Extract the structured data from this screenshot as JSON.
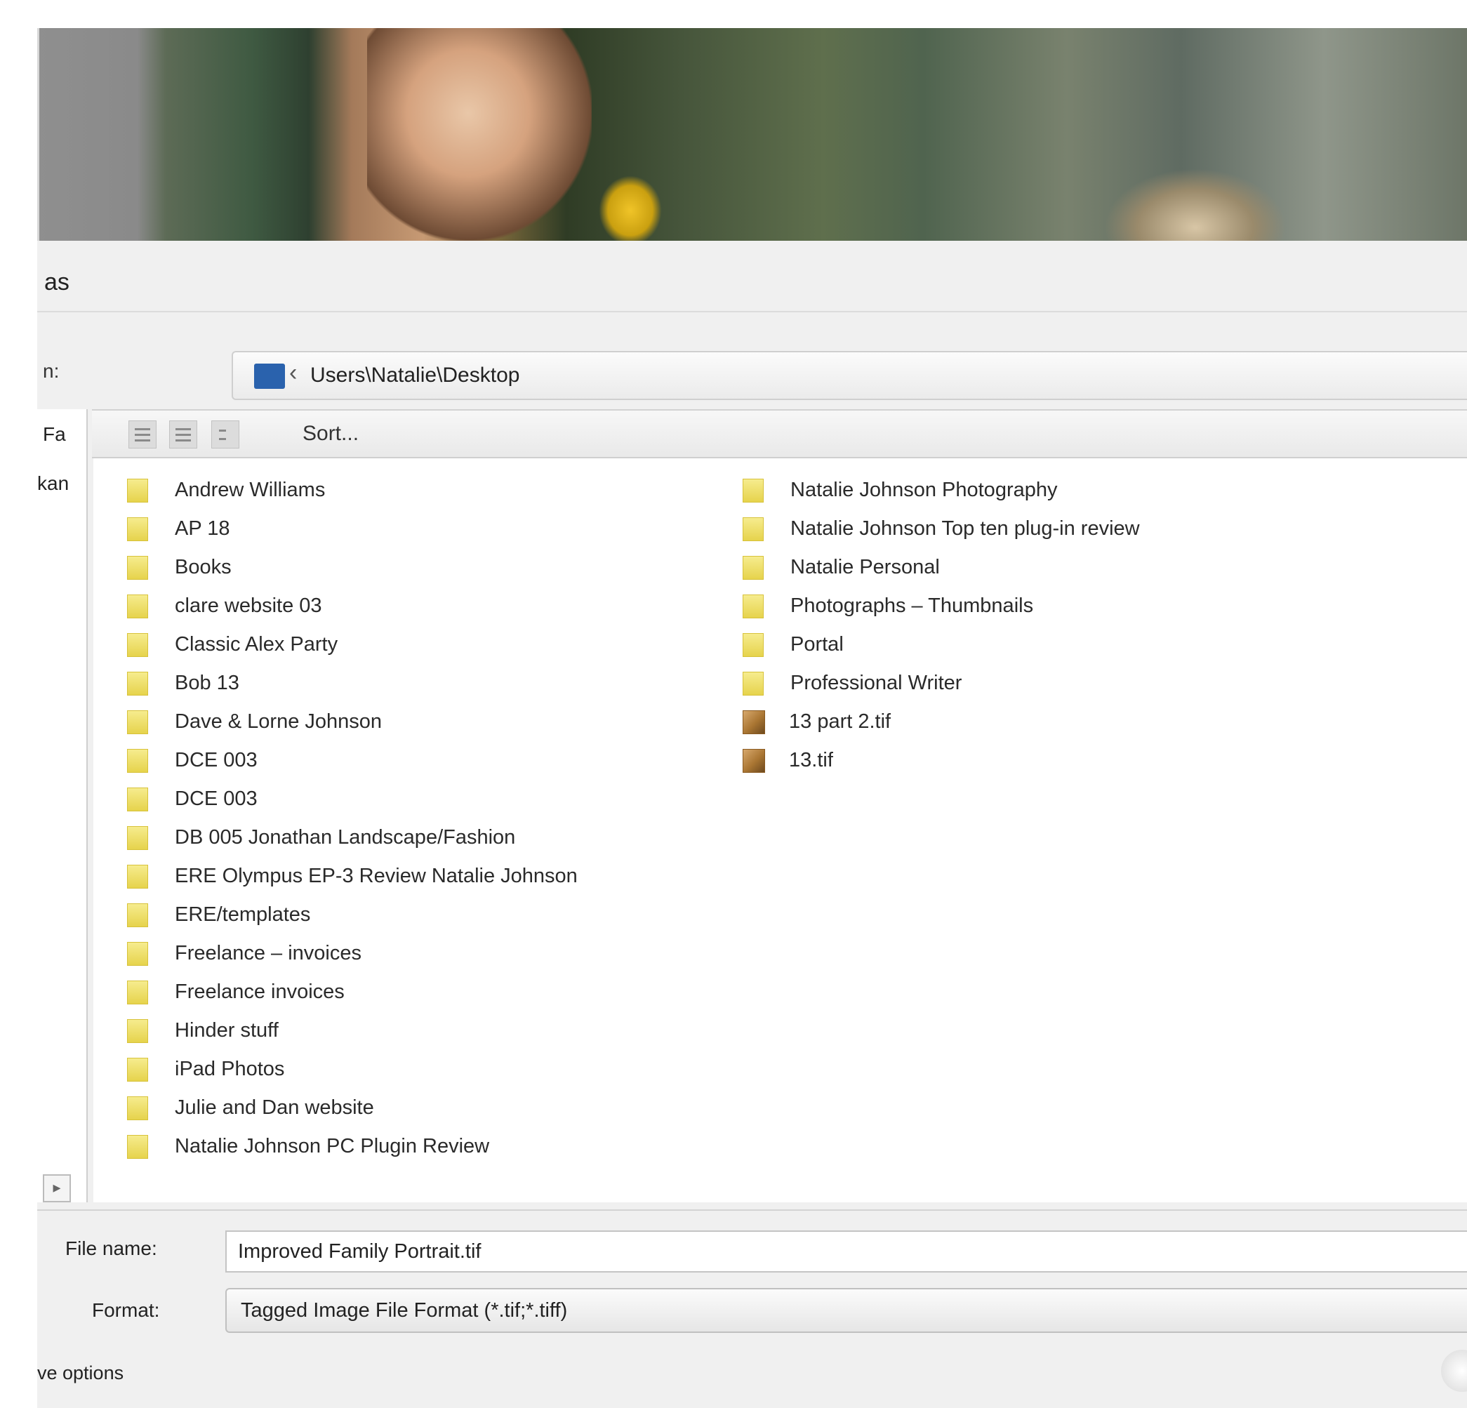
{
  "dialog": {
    "title": "as",
    "save_in_label": "n:",
    "path": "Users\\Natalie\\Desktop",
    "toolbar": {
      "sort_label": "Sort..."
    },
    "nav": {
      "item1": "Fa",
      "item2": "kan"
    },
    "files_left": [
      "Andrew Williams",
      "AP 18",
      "Books",
      "clare website 03",
      "Classic Alex Party",
      "Bob 13",
      "Dave & Lorne Johnson",
      "DCE 003",
      "DCE 003",
      "DB 005 Jonathan Landscape/Fashion",
      "ERE Olympus EP-3 Review Natalie Johnson",
      "ERE/templates",
      "Freelance – invoices",
      "Freelance invoices",
      "Hinder stuff",
      "iPad Photos",
      "Julie and Dan website",
      "Natalie Johnson PC Plugin Review"
    ],
    "files_right": [
      "Natalie Johnson Photography",
      "Natalie Johnson Top ten plug-in review",
      "Natalie Personal",
      "Photographs – Thumbnails",
      "Portal",
      "Professional Writer"
    ],
    "images_right": [
      "13 part 2.tif",
      "13.tif"
    ],
    "file_name_label": "File name:",
    "file_name_value": "Improved Family Portrait.tif",
    "format_label": "Format:",
    "format_value": "Tagged Image File Format (*.tif;*.tiff)",
    "save_options_label": "ve options"
  }
}
